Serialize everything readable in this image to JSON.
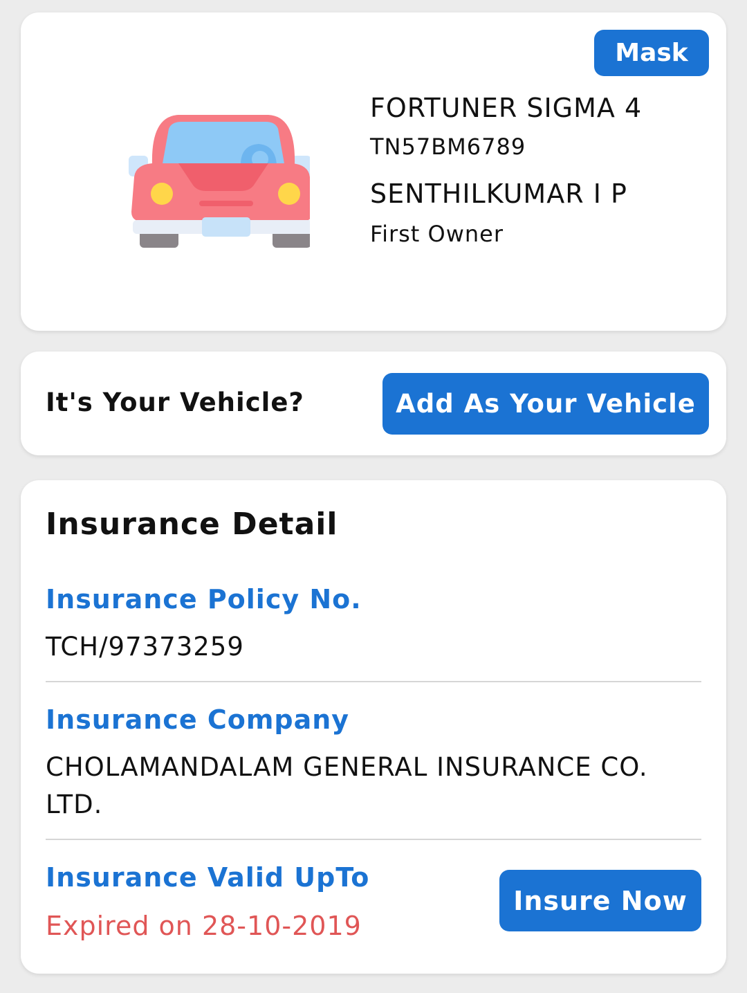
{
  "vehicle": {
    "mask_label": "Mask",
    "model": "FORTUNER SIGMA 4",
    "registration": "TN57BM6789",
    "owner_name": "SENTHILKUMAR I P",
    "owner_type": "First Owner"
  },
  "ownership": {
    "question": "It's Your Vehicle?",
    "add_button_label": "Add As Your Vehicle"
  },
  "insurance": {
    "title": "Insurance Detail",
    "policy_label": "Insurance Policy No.",
    "policy_value": "TCH/97373259",
    "company_label": "Insurance Company",
    "company_value": "CHOLAMANDALAM GENERAL INSURANCE CO. LTD.",
    "valid_label": "Insurance Valid UpTo",
    "valid_value": "Expired on 28-10-2019",
    "insure_button_label": "Insure Now"
  },
  "colors": {
    "accent": "#1b73d3",
    "expired": "#e05656",
    "background": "#ececec",
    "car_body": "#f77b84"
  },
  "icons": {
    "vehicle_illustration": "car-icon"
  }
}
